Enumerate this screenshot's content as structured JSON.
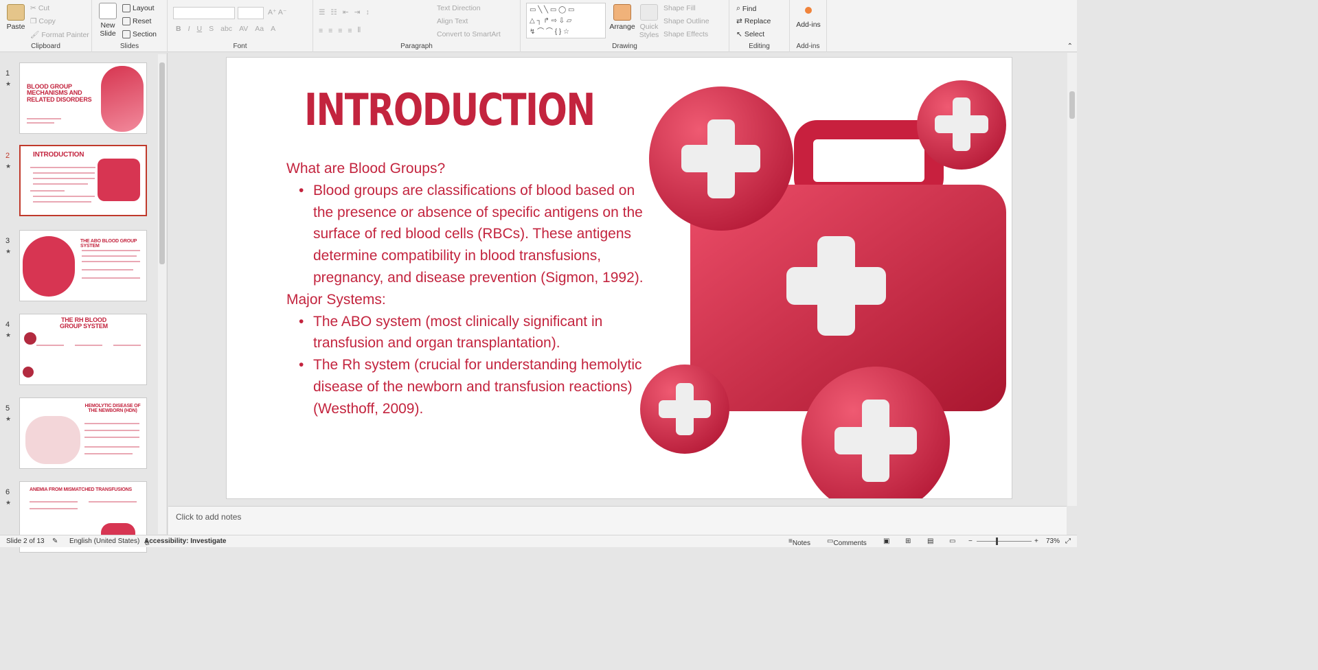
{
  "ribbon": {
    "clipboard": {
      "label": "Clipboard",
      "paste": "Paste",
      "cut": "Cut",
      "copy": "Copy",
      "format_painter": "Format Painter"
    },
    "slides": {
      "label": "Slides",
      "new_slide": "New Slide",
      "layout": "Layout",
      "reset": "Reset",
      "section": "Section"
    },
    "font": {
      "label": "Font"
    },
    "paragraph": {
      "label": "Paragraph",
      "text_direction": "Text Direction",
      "align_text": "Align Text",
      "convert_smartart": "Convert to SmartArt"
    },
    "drawing": {
      "label": "Drawing",
      "arrange": "Arrange",
      "quick_styles": "Quick Styles",
      "shape_fill": "Shape Fill",
      "shape_outline": "Shape Outline",
      "shape_effects": "Shape Effects"
    },
    "editing": {
      "label": "Editing",
      "find": "Find",
      "replace": "Replace",
      "select": "Select"
    },
    "addins": {
      "label": "Add-ins",
      "addins": "Add-ins"
    }
  },
  "thumbnails": [
    {
      "num": "1",
      "title": "BLOOD GROUP MECHANISMS AND RELATED DISORDERS"
    },
    {
      "num": "2",
      "title": "INTRODUCTION"
    },
    {
      "num": "3",
      "title": "THE ABO BLOOD GROUP SYSTEM"
    },
    {
      "num": "4",
      "title": "THE RH BLOOD GROUP SYSTEM"
    },
    {
      "num": "5",
      "title": "HEMOLYTIC DISEASE OF THE NEWBORN (HDN)"
    },
    {
      "num": "6",
      "title": "ANEMIA FROM MISMATCHED TRANSFUSIONS"
    }
  ],
  "slide": {
    "title": "INTRODUCTION",
    "heading1": "What are Blood Groups?",
    "bullet1": "Blood groups are classifications of blood based on the presence or absence of specific antigens on the surface of red blood cells (RBCs). These antigens determine compatibility in blood transfusions, pregnancy, and disease prevention (Sigmon, 1992).",
    "heading2": "Major Systems:",
    "bullet2": "The ABO system (most clinically significant in transfusion and organ transplantation).",
    "bullet3": "The Rh system (crucial for understanding hemolytic disease of the newborn and transfusion reactions)(Westhoff, 2009)."
  },
  "notes": {
    "placeholder": "Click to add notes"
  },
  "status": {
    "slide_count": "Slide 2 of 13",
    "language": "English (United States)",
    "accessibility": "Accessibility: Investigate",
    "notes": "Notes",
    "comments": "Comments",
    "zoom": "73%"
  },
  "colors": {
    "accent": "#c3243e",
    "selection": "#c0392b"
  }
}
